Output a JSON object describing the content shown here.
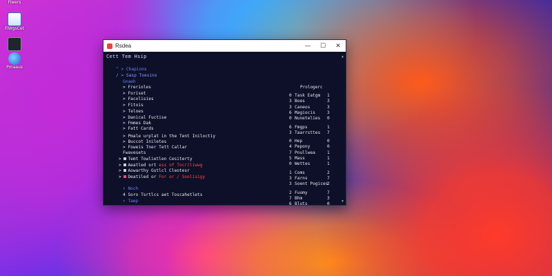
{
  "desktop": {
    "icons": [
      {
        "label": "Fiwers"
      },
      {
        "label": "FiWgsCet"
      },
      {
        "label": ""
      },
      {
        "label": "Pmaaus"
      }
    ]
  },
  "window": {
    "title": "Rsdea",
    "controls": {
      "minimize": "—",
      "maximize": "☐",
      "close": "✕"
    }
  },
  "menu": "Cett Tem Hsip",
  "left": [
    {
      "prefix": "^ >",
      "text": "Chapions",
      "color": "blue"
    },
    {
      "prefix": "/ >",
      "text": "Sasp Toesins",
      "color": "blue2"
    },
    {
      "prefix": "",
      "text": "Gnaeh",
      "color": "blue"
    },
    {
      "prefix": ">",
      "text": "Frerioles",
      "color": "w"
    },
    {
      "prefix": ">",
      "text": "Foriset",
      "color": "w"
    },
    {
      "prefix": ">",
      "text": "Facolisies",
      "color": "w"
    },
    {
      "prefix": ">",
      "text": "Fitois",
      "color": "w"
    },
    {
      "prefix": ">",
      "text": "Teloes",
      "color": "w"
    },
    {
      "prefix": ">",
      "text": "Danical Fuctise",
      "color": "w"
    },
    {
      "prefix": ">",
      "text": "Fmmes Dak",
      "color": "w"
    },
    {
      "prefix": ">",
      "text": "Fatt Cards",
      "color": "w"
    },
    {
      "prefix": ">",
      "text": "Pmale urplat in the Tent Iniloctiy",
      "color": "w"
    },
    {
      "prefix": ">",
      "text": "Buccot Iniletes",
      "color": "w"
    },
    {
      "prefix": ">",
      "text": "Foweis Tner Tett Callar",
      "color": "w"
    },
    {
      "prefix": "",
      "text": "Fwavesets",
      "color": "w"
    },
    {
      "prefix": ">",
      "sq": "w",
      "text": "Temt Towlietlen Cesiterty",
      "color": "w"
    },
    {
      "prefix": ">",
      "sq": "w",
      "text": "Aeatled ort",
      "red": "ess of Tocriliwwg",
      "color": "w"
    },
    {
      "prefix": ">",
      "sq": "w",
      "text": "Aowarthy Gstlcl Cleotesr",
      "color": "w"
    },
    {
      "prefix": ">",
      "sq": "r",
      "text": "Deatiled or",
      "red": "For or / Soolisigy",
      "color": "w"
    },
    {
      "prefix": "",
      "text": "",
      "color": "w"
    },
    {
      "prefix": "↑",
      "text": "Noch",
      "color": "blue"
    },
    {
      "prefix": "4",
      "text": "Soro Tsrtlcs aet Toscahetlets",
      "color": "w"
    },
    {
      "prefix": "↑",
      "text": "Taep",
      "color": "blue"
    }
  ],
  "right_header": "Prologerc",
  "right": [
    {
      "k": "0",
      "label": "Task Eatgm",
      "v": "1"
    },
    {
      "k": "3",
      "label": "Boes",
      "v": "3"
    },
    {
      "k": "3",
      "label": "Caneos",
      "v": "3"
    },
    {
      "k": "6",
      "label": "Magiocis",
      "v": "3"
    },
    {
      "k": "0",
      "label": "Nunetelies",
      "v": "0"
    },
    {
      "k": "",
      "label": "",
      "v": ""
    },
    {
      "k": "6",
      "label": "Fmgps",
      "v": "1"
    },
    {
      "k": "3",
      "label": "Taarrsttes",
      "v": "7"
    },
    {
      "k": "",
      "label": "",
      "v": ""
    },
    {
      "k": "0",
      "label": "Hep",
      "v": "0"
    },
    {
      "k": "4",
      "label": "Pepony",
      "v": "0"
    },
    {
      "k": "7",
      "label": "Pnullwea",
      "v": "1"
    },
    {
      "k": "5",
      "label": "Mass",
      "v": "1"
    },
    {
      "k": "0",
      "label": "Wettes",
      "v": "1"
    },
    {
      "k": "",
      "label": "",
      "v": ""
    },
    {
      "k": "1",
      "label": "Coms",
      "v": "2"
    },
    {
      "k": "3",
      "label": "Farns",
      "v": "7"
    },
    {
      "k": "3",
      "label": "Soent Pogices",
      "v": "2"
    },
    {
      "k": "",
      "label": "",
      "v": ""
    },
    {
      "k": "2",
      "label": "Fuomy",
      "v": "7"
    },
    {
      "k": "7",
      "label": "Bhm",
      "v": "3"
    },
    {
      "k": "6",
      "label": "Bluts",
      "v": "0"
    }
  ]
}
